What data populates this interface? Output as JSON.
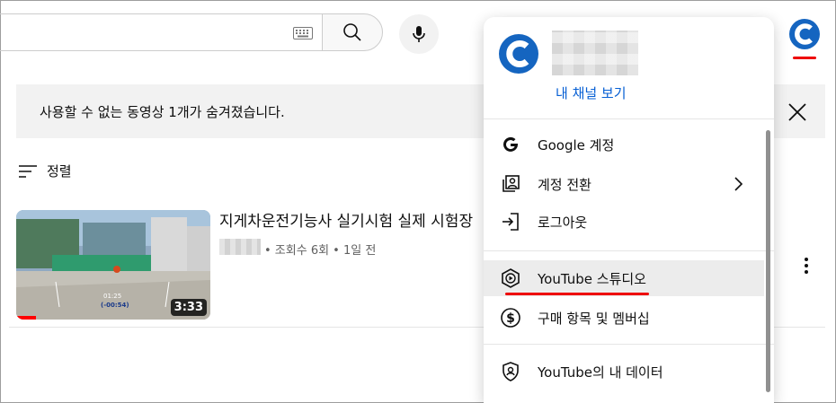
{
  "notice": {
    "text": "사용할 수 없는 동영상 1개가 숨겨졌습니다."
  },
  "sort": {
    "label": "정렬"
  },
  "video": {
    "title": "지게차운전기능사 실기시험 실제 시험장",
    "meta": "• 조회수 6회 • 1일 전",
    "duration": "3:33",
    "overlay_time": "01:25",
    "overlay_remaining": "(-00:54)",
    "watched_fraction": 0.1
  },
  "account_menu": {
    "view_channel": "내 채널 보기",
    "items": [
      {
        "label": "Google 계정",
        "icon": "google-icon"
      },
      {
        "label": "계정 전환",
        "icon": "switch-account-icon"
      },
      {
        "label": "로그아웃",
        "icon": "sign-out-icon"
      },
      {
        "label": "YouTube 스튜디오",
        "icon": "studio-icon"
      },
      {
        "label": "구매 항목 및 멤버십",
        "icon": "dollar-icon"
      },
      {
        "label": "YouTube의 내 데이터",
        "icon": "shield-person-icon"
      }
    ]
  },
  "colors": {
    "accent_blue": "#065fd4",
    "avatar_blue": "#1565c0",
    "highlight_red": "#e00000"
  }
}
